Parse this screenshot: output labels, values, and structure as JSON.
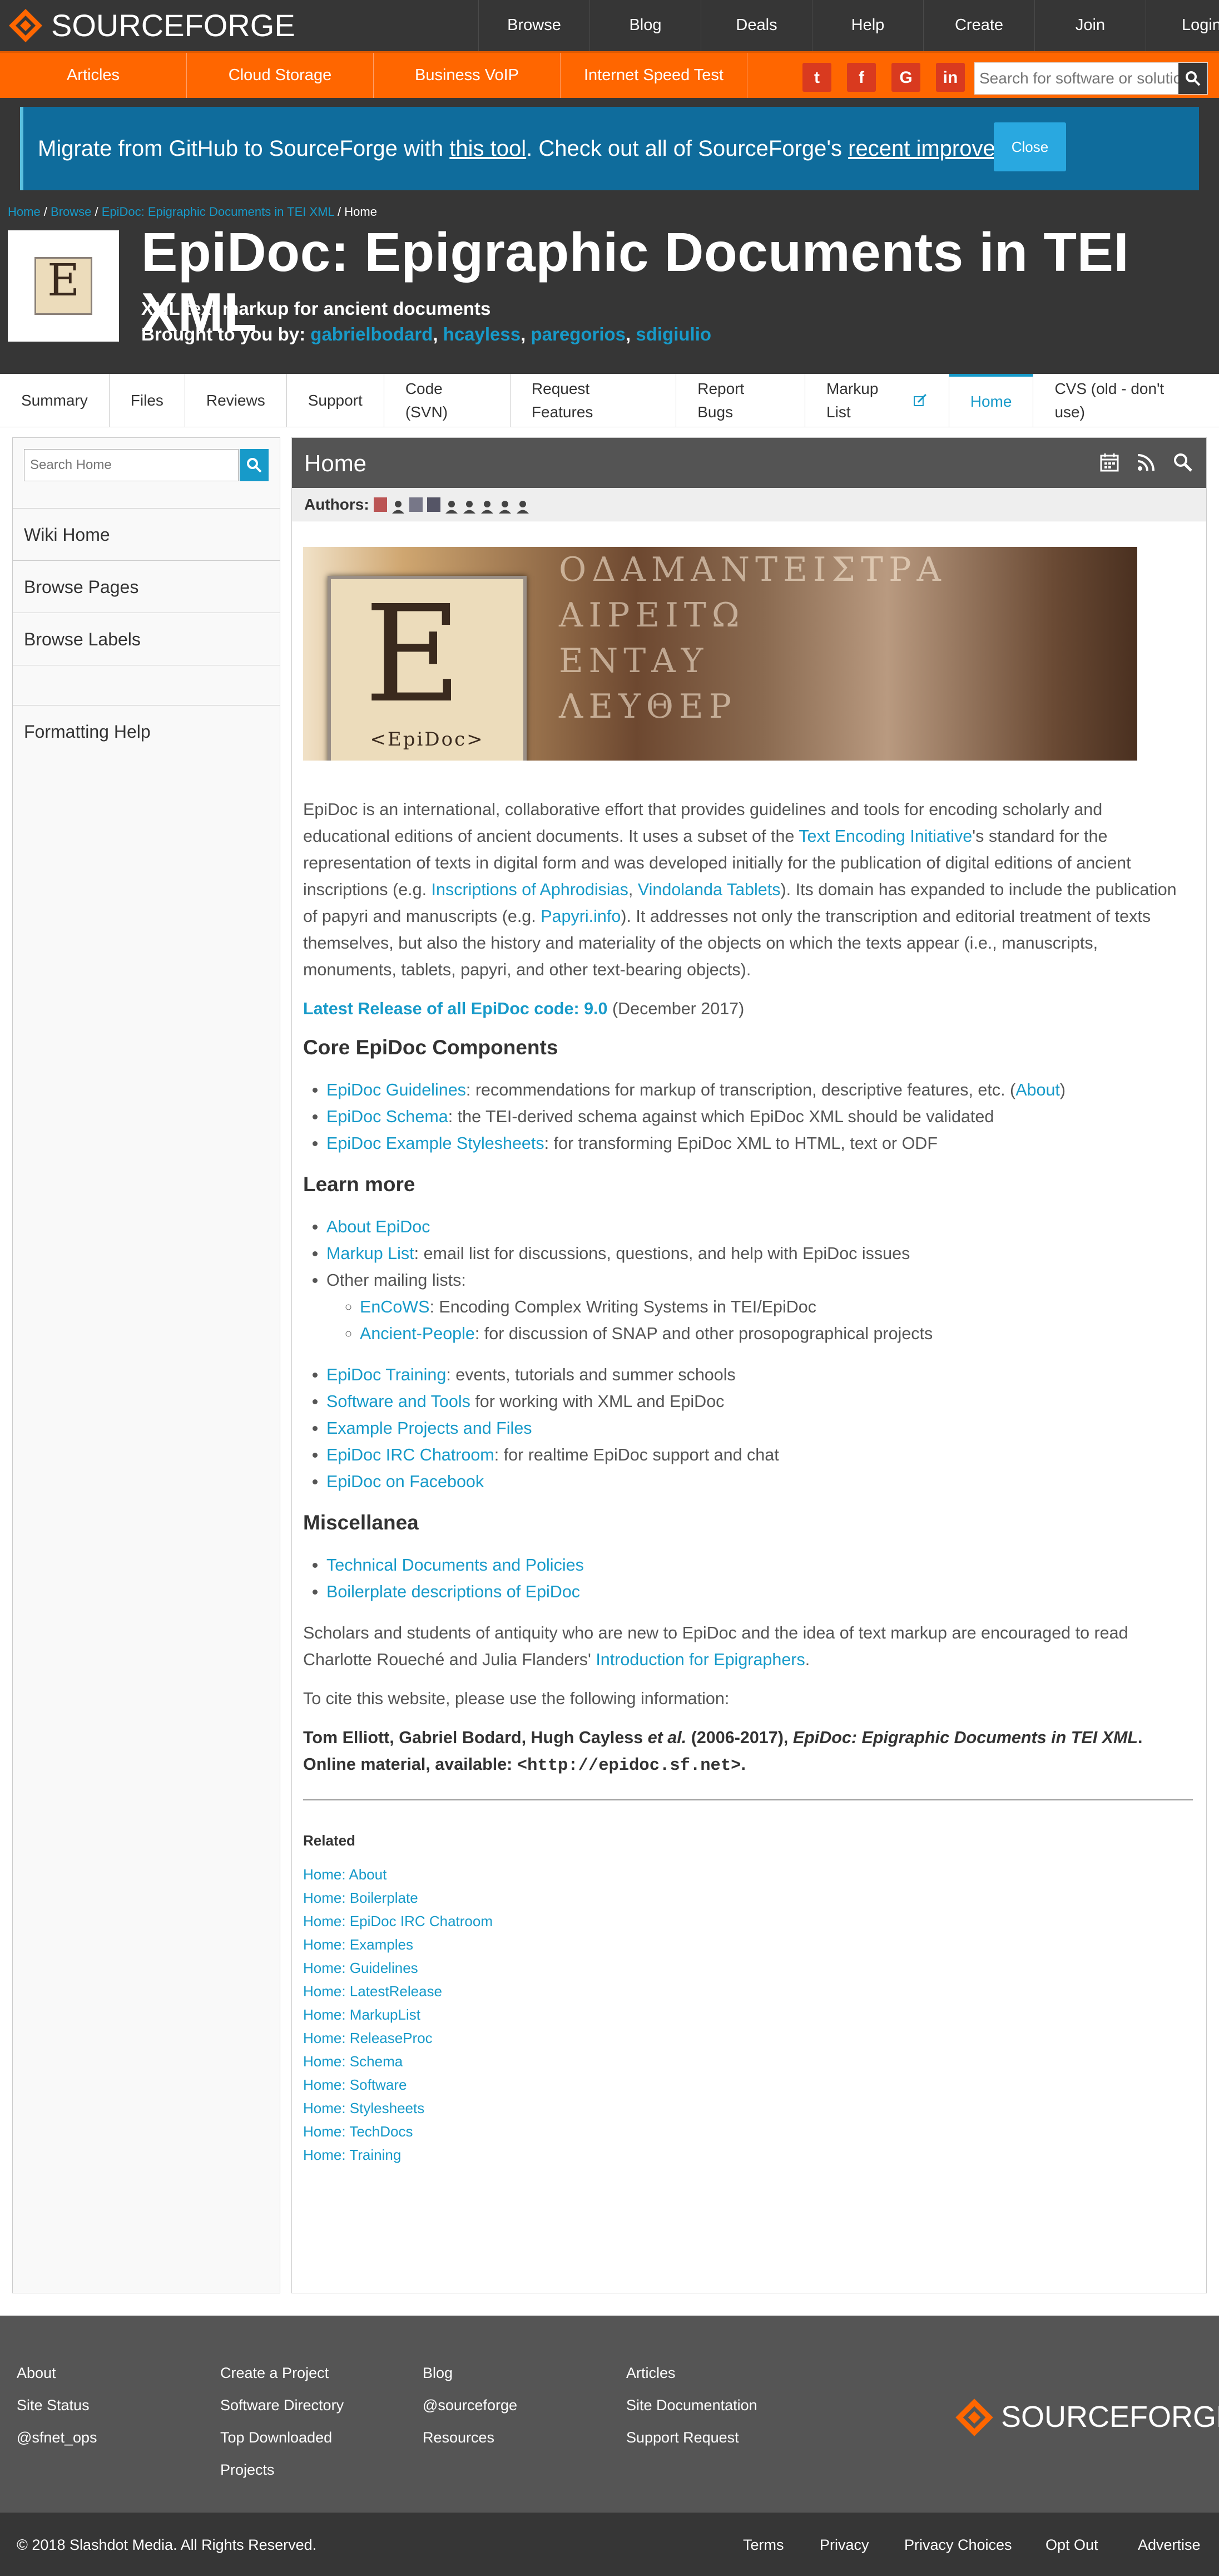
{
  "topnav": {
    "brand": "SOURCEFORGE",
    "links": [
      "Browse",
      "Blog",
      "Deals",
      "Help",
      "Create",
      "Join",
      "Login"
    ]
  },
  "orangebar": {
    "links": [
      "Articles",
      "Cloud Storage",
      "Business VoIP",
      "Internet Speed Test"
    ],
    "social": [
      "twitter-icon",
      "facebook-icon",
      "google-icon",
      "linkedin-icon"
    ],
    "search_placeholder": "Search for software or solutions"
  },
  "banner": {
    "text_before": "Migrate from GitHub to SourceForge with ",
    "link1": "this tool",
    "text_mid": ". Check out all of SourceForge's ",
    "link2": "recent improvements.",
    "close": "Close"
  },
  "breadcrumb": {
    "items": [
      "Home",
      "Browse",
      "EpiDoc: Epigraphic Documents in TEI XML"
    ],
    "current": "Home",
    "sep": " / "
  },
  "project": {
    "title": "EpiDoc: Epigraphic Documents in TEI XML",
    "subtitle": "XML text markup for ancient documents",
    "brought_by": "Brought to you by:",
    "authors": [
      "gabrielbodard",
      "hcayless",
      "paregorios",
      "sdigiulio"
    ]
  },
  "tabs": [
    "Summary",
    "Files",
    "Reviews",
    "Support",
    "Code (SVN)",
    "Request Features",
    "Report Bugs",
    "Markup List",
    "Home",
    "CVS (old - don't use)"
  ],
  "active_tab": "Home",
  "sidebar": {
    "search_placeholder": "Search Home",
    "items": [
      "Wiki Home",
      "Browse Pages",
      "Browse Labels",
      "",
      "Formatting Help"
    ]
  },
  "page": {
    "heading": "Home",
    "authors_label": "Authors:"
  },
  "content": {
    "banner_logo_text": "<EpiDoc>",
    "banner_logo_letter": "E",
    "stone_lines": [
      "ΟΔΑΜΑΝΤΕΙΣΤΡΑ",
      "ΑΙΡΕΙΤΩ",
      "ΕΝΤΑΥ",
      "ΛΕΥΘΕΡ"
    ],
    "intro": {
      "p1": "EpiDoc is an international, collaborative effort that provides guidelines and tools for encoding scholarly and educational editions of ancient documents. It uses a subset of the ",
      "l1": "Text Encoding Initiative",
      "p2": "'s standard for the representation of texts in digital form and was developed initially for the publication of digital editions of ancient inscriptions (e.g. ",
      "l2": "Inscriptions of Aphrodisias",
      "p3": ", ",
      "l3": "Vindolanda Tablets",
      "p4": "). Its domain has expanded to include the publication of papyri and manuscripts (e.g. ",
      "l4": "Papyri.info",
      "p5": "). It addresses not only the transcription and editorial treatment of texts themselves, but also the history and materiality of the objects on which the texts appear (i.e., manuscripts, monuments, tablets, papyri, and other text-bearing objects)."
    },
    "release_link": "Latest Release of all EpiDoc code: 9.0",
    "release_date": " (December 2017)",
    "core_heading": "Core EpiDoc Components",
    "core": [
      {
        "link": "EpiDoc Guidelines",
        "text": ": recommendations for markup of transcription, descriptive features, etc. (",
        "link2": "About",
        "tail": ")"
      },
      {
        "link": "EpiDoc Schema",
        "text": ": the TEI-derived schema against which EpiDoc XML should be validated"
      },
      {
        "link": "EpiDoc Example Stylesheets",
        "text": ": for transforming EpiDoc XML to HTML, text or ODF"
      }
    ],
    "learn_heading": "Learn more",
    "learn": [
      {
        "link": "About EpiDoc",
        "text": ""
      },
      {
        "link": "Markup List",
        "text": ": email list for discussions, questions, and help with EpiDoc issues"
      },
      {
        "link": "",
        "text": "Other mailing lists:"
      }
    ],
    "mailing": [
      {
        "link": "EnCoWS",
        "text": ": Encoding Complex Writing Systems in TEI/EpiDoc"
      },
      {
        "link": "Ancient-People",
        "text": ": for discussion of SNAP and other prosopographical projects"
      }
    ],
    "learn2": [
      {
        "link": "EpiDoc Training",
        "text": ": events, tutorials and summer schools"
      },
      {
        "link": "Software and Tools",
        "text": " for working with XML and EpiDoc"
      },
      {
        "link": "Example Projects and Files",
        "text": ""
      },
      {
        "link": "EpiDoc IRC Chatroom",
        "text": ": for realtime EpiDoc support and chat"
      },
      {
        "link": "EpiDoc on Facebook",
        "text": ""
      }
    ],
    "misc_heading": "Miscellanea",
    "misc": [
      "Technical Documents and Policies",
      "Boilerplate descriptions of EpiDoc"
    ],
    "scholars_text": "Scholars and students of antiquity who are new to EpiDoc and the idea of text markup are encouraged to read Charlotte Roueché and Julia Flanders' ",
    "scholars_link": "Introduction for Epigraphers",
    "scholars_end": ".",
    "cite_intro": "To cite this website, please use the following information:",
    "cite": {
      "names": "Tom Elliott, Gabriel Bodard, Hugh Cayless ",
      "etal": "et al.",
      "years": " (2006-2017), ",
      "work": "EpiDoc: Epigraphic Documents in TEI XML",
      "online": ". Online material, available: ",
      "url": "<http://epidoc.sf.net>",
      "end": "."
    },
    "related_heading": "Related",
    "related": [
      "Home: About",
      "Home: Boilerplate",
      "Home: EpiDoc IRC Chatroom",
      "Home: Examples",
      "Home: Guidelines",
      "Home: LatestRelease",
      "Home: MarkupList",
      "Home: ReleaseProc",
      "Home: Schema",
      "Home: Software",
      "Home: Stylesheets",
      "Home: TechDocs",
      "Home: Training"
    ]
  },
  "footer": {
    "col1": [
      "About",
      "Site Status",
      "@sfnet_ops"
    ],
    "col2": [
      "Create a Project",
      "Software Directory",
      "Top Downloaded",
      "Projects"
    ],
    "col3": [
      "Blog",
      "@sourceforge",
      "Resources"
    ],
    "col4": [
      "Articles",
      "Site Documentation",
      "Support Request"
    ],
    "brand": "SOURCEFORGE",
    "copyright": "© 2018 Slashdot Media. All Rights Reserved.",
    "bottom_links": [
      "Terms",
      "Privacy",
      "Privacy Choices",
      "Opt Out",
      "Advertise"
    ]
  },
  "colors": {
    "accent": "#179ac9",
    "orange": "#ff6600",
    "dark": "#363636"
  }
}
